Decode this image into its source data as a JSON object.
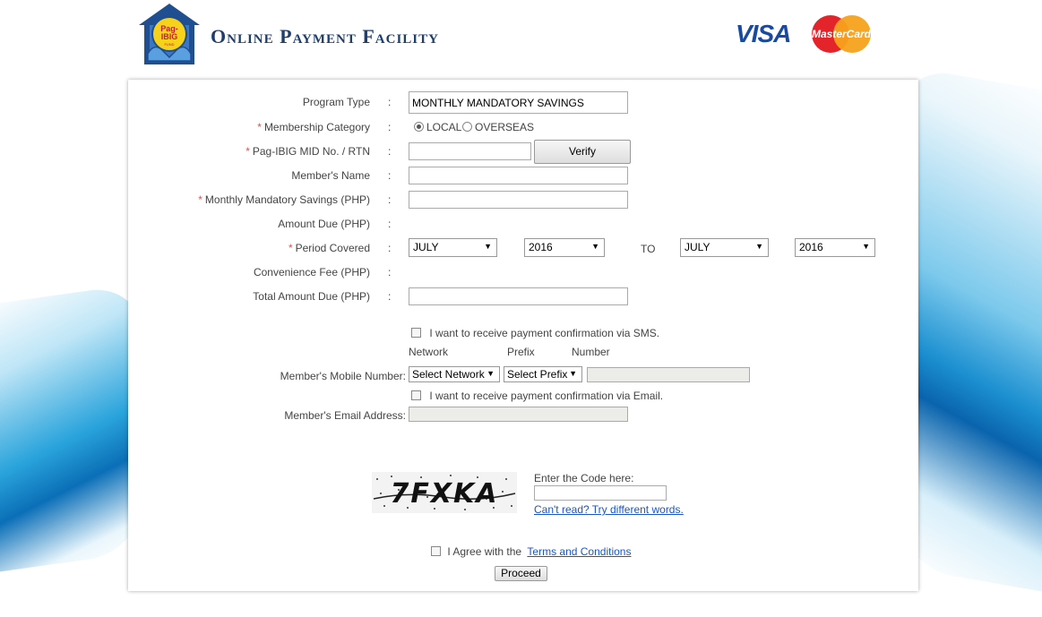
{
  "header": {
    "brand_title": "Online Payment Facility",
    "logo_text_top": "Pag-",
    "logo_text_bottom": "IBIG",
    "logo_text_small": "FUND",
    "visa_label": "VISA",
    "mastercard_label": "MasterCard"
  },
  "form": {
    "program_type": {
      "label": "Program Type",
      "value": "MONTHLY MANDATORY SAVINGS"
    },
    "membership_category": {
      "label": "Membership Category",
      "options": [
        "LOCAL",
        "OVERSEAS"
      ],
      "selected": "LOCAL"
    },
    "mid_no": {
      "label": "Pag-IBIG MID No. / RTN",
      "value": "",
      "verify_label": "Verify"
    },
    "member_name": {
      "label": "Member's Name",
      "value": ""
    },
    "monthly_savings": {
      "label": "Monthly Mandatory Savings (PHP)",
      "value": ""
    },
    "amount_due": {
      "label": "Amount Due (PHP)",
      "value": ""
    },
    "period_covered": {
      "label": "Period Covered",
      "from_month": "JULY",
      "from_year": "2016",
      "to_label": "TO",
      "to_month": "JULY",
      "to_year": "2016"
    },
    "convenience_fee": {
      "label": "Convenience Fee (PHP)",
      "value": ""
    },
    "total_amount_due": {
      "label": "Total Amount Due (PHP)",
      "value": ""
    },
    "sms": {
      "checkbox_label": "I want to receive payment confirmation via SMS.",
      "col_network": "Network",
      "col_prefix": "Prefix",
      "col_number": "Number",
      "mobile_label": "Member's Mobile Number:",
      "network_value": "Select Network",
      "prefix_value": "Select Prefix",
      "number_value": ""
    },
    "email": {
      "checkbox_label": "I want to receive payment confirmation via Email.",
      "address_label": "Member's Email Address:",
      "address_value": ""
    },
    "colon": ":",
    "required_mark": "*"
  },
  "captcha": {
    "image_text": "7FXKA",
    "enter_label": "Enter the Code here:",
    "value": "",
    "refresh_link": "Can't read? Try different words."
  },
  "agreement": {
    "prefix": "I Agree with the",
    "link": "Terms and Conditions",
    "proceed_label": "Proceed"
  }
}
